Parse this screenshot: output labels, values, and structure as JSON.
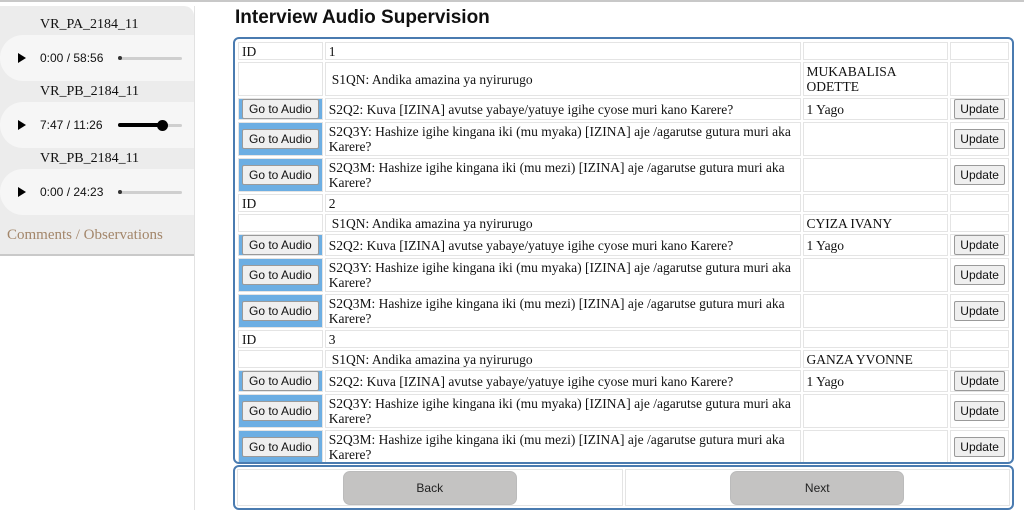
{
  "sidebar": {
    "players": [
      {
        "title": "VR_PA_2184_11",
        "time": "0:00 / 58:56",
        "progress": 0.0
      },
      {
        "title": "VR_PB_2184_11",
        "time": "7:47 / 11:26",
        "progress": 0.68
      },
      {
        "title": "VR_PB_2184_11",
        "time": "0:00 / 24:23",
        "progress": 0.0
      }
    ],
    "comments_label": "Comments / Observations"
  },
  "header": {
    "title": "Interview Audio Supervision"
  },
  "table": {
    "goto_label": "Go to Audio",
    "update_label": "Update",
    "id_label": "ID",
    "groups": [
      {
        "id": "1",
        "s1qn": {
          "question": "S1QN: Andika amazina ya nyirurugo",
          "answer": "MUKABALISA ODETTE"
        },
        "rows": [
          {
            "question": "S2Q2: Kuva [IZINA] avutse yabaye/yatuye igihe cyose muri kano Karere?",
            "answer": "1 Yago"
          },
          {
            "question": "S2Q3Y: Hashize igihe kingana iki (mu myaka) [IZINA] aje /agarutse gutura muri aka Karere?",
            "answer": ""
          },
          {
            "question": "S2Q3M: Hashize igihe kingana iki (mu mezi) [IZINA] aje /agarutse gutura muri aka Karere?",
            "answer": ""
          }
        ]
      },
      {
        "id": "2",
        "s1qn": {
          "question": "S1QN: Andika amazina ya nyirurugo",
          "answer": "CYIZA IVANY"
        },
        "rows": [
          {
            "question": "S2Q2: Kuva [IZINA] avutse yabaye/yatuye igihe cyose muri kano Karere?",
            "answer": "1 Yago"
          },
          {
            "question": "S2Q3Y: Hashize igihe kingana iki (mu myaka) [IZINA] aje /agarutse gutura muri aka Karere?",
            "answer": ""
          },
          {
            "question": "S2Q3M: Hashize igihe kingana iki (mu mezi) [IZINA] aje /agarutse gutura muri aka Karere?",
            "answer": ""
          }
        ]
      },
      {
        "id": "3",
        "s1qn": {
          "question": "S1QN: Andika amazina ya nyirurugo",
          "answer": "GANZA YVONNE"
        },
        "rows": [
          {
            "question": "S2Q2: Kuva [IZINA] avutse yabaye/yatuye igihe cyose muri kano Karere?",
            "answer": "1 Yago"
          },
          {
            "question": "S2Q3Y: Hashize igihe kingana iki (mu myaka) [IZINA] aje /agarutse gutura muri aka Karere?",
            "answer": ""
          },
          {
            "question": "S2Q3M: Hashize igihe kingana iki (mu mezi) [IZINA] aje /agarutse gutura muri aka Karere?",
            "answer": ""
          }
        ]
      }
    ]
  },
  "nav": {
    "back_label": "Back",
    "next_label": "Next"
  },
  "colors": {
    "accent_border": "#4a7bb0",
    "button_cell": "#6caee3",
    "comments_text": "#a3866a"
  }
}
